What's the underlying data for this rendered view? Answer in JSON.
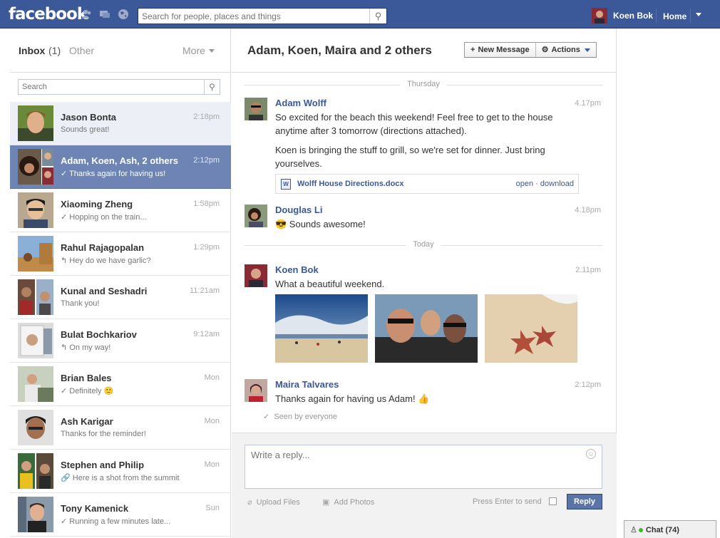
{
  "header": {
    "logo": "facebook",
    "search_placeholder": "Search for people, places and things",
    "user_name": "Koen Bok",
    "home_label": "Home"
  },
  "sidebar": {
    "inbox_label": "Inbox",
    "inbox_count": "(1)",
    "other_label": "Other",
    "more_label": "More",
    "search_placeholder": "Search",
    "threads": [
      {
        "name": "Jason Bonta",
        "snippet": "Sounds great!",
        "time": "2:18pm",
        "state": "unread",
        "prefix": ""
      },
      {
        "name": "Adam, Koen, Ash, 2 others",
        "snippet": "Thanks again for having us!",
        "time": "2:12pm",
        "state": "selected",
        "prefix": "✓"
      },
      {
        "name": "Xiaoming Zheng",
        "snippet": "Hopping on the train...",
        "time": "1:58pm",
        "state": "",
        "prefix": "✓"
      },
      {
        "name": "Rahul Rajagopalan",
        "snippet": "Hey do we have garlic?",
        "time": "1:29pm",
        "state": "",
        "prefix": "↰"
      },
      {
        "name": "Kunal and Seshadri",
        "snippet": "Thank you!",
        "time": "11:21am",
        "state": "",
        "prefix": ""
      },
      {
        "name": "Bulat Bochkariov",
        "snippet": "On my way!",
        "time": "9:12am",
        "state": "",
        "prefix": "↰"
      },
      {
        "name": "Brian Bales",
        "snippet": "Definitely 🙂",
        "time": "Mon",
        "state": "",
        "prefix": "✓"
      },
      {
        "name": "Ash Karigar",
        "snippet": "Thanks for the reminder!",
        "time": "Mon",
        "state": "",
        "prefix": ""
      },
      {
        "name": "Stephen and Philip",
        "snippet": "Here is a shot from the summit",
        "time": "Mon",
        "state": "",
        "prefix": "🔗"
      },
      {
        "name": "Tony Kamenick",
        "snippet": "Running a few minutes late...",
        "time": "Sun",
        "state": "",
        "prefix": "✓"
      }
    ]
  },
  "conversation": {
    "title": "Adam, Koen, Maira and 2 others",
    "new_message_label": "New Message",
    "actions_label": "Actions",
    "day1": "Thursday",
    "day2": "Today",
    "messages": [
      {
        "author": "Adam Wolff",
        "time": "4.17pm",
        "p1": "So excited for the beach this weekend! Feel free to get to the house anytime after 3 tomorrow (directions attached).",
        "p2": "Koen is bringing the stuff to grill, so we're set for dinner. Just bring yourselves."
      },
      {
        "author": "Douglas Li",
        "time": "4.18pm",
        "p1": "😎 Sounds awesome!"
      },
      {
        "author": "Koen Bok",
        "time": "2.11pm",
        "p1": "What a beautiful weekend."
      },
      {
        "author": "Maira Talvares",
        "time": "2:12pm",
        "p1": "Thanks again for having us Adam! 👍"
      }
    ],
    "attachment": {
      "filename": "Wolff House Directions.docx",
      "links": "open · download"
    },
    "seen": "Seen by everyone"
  },
  "composer": {
    "placeholder": "Write a reply...",
    "upload_label": "Upload Files",
    "photos_label": "Add Photos",
    "enter_label": "Press Enter to send",
    "reply_label": "Reply"
  },
  "chat": {
    "label": "Chat (74)"
  },
  "colors": {
    "brand": "#3b5998",
    "selected": "#6d84b4"
  }
}
